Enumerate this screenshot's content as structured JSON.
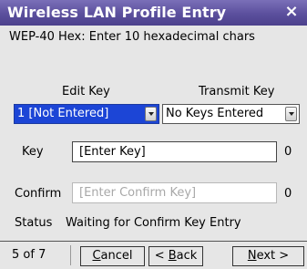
{
  "window": {
    "title": "Wireless LAN Profile Entry",
    "close_symbol": "×"
  },
  "instructions": "WEP-40 Hex: Enter 10 hexadecimal chars",
  "edit_key": {
    "label": "Edit Key",
    "value": "1 [Not Entered]"
  },
  "transmit_key": {
    "label": "Transmit Key",
    "value": "No Keys Entered"
  },
  "key": {
    "label": "Key",
    "placeholder": "[Enter Key]",
    "count": "0"
  },
  "confirm": {
    "label": "Confirm",
    "placeholder": "[Enter Confirm Key]",
    "count": "0"
  },
  "status": {
    "label": "Status",
    "value": "Waiting for Confirm Key Entry"
  },
  "footer": {
    "page": "5 of 7",
    "cancel": {
      "mnemonic": "C",
      "rest": "ancel"
    },
    "back": {
      "prefix": "< ",
      "mnemonic": "B",
      "rest": "ack"
    },
    "next": {
      "mnemonic": "N",
      "rest": "ext >"
    }
  },
  "colors": {
    "title_bar": "#5b4f9d",
    "selection": "#1c45d6"
  }
}
